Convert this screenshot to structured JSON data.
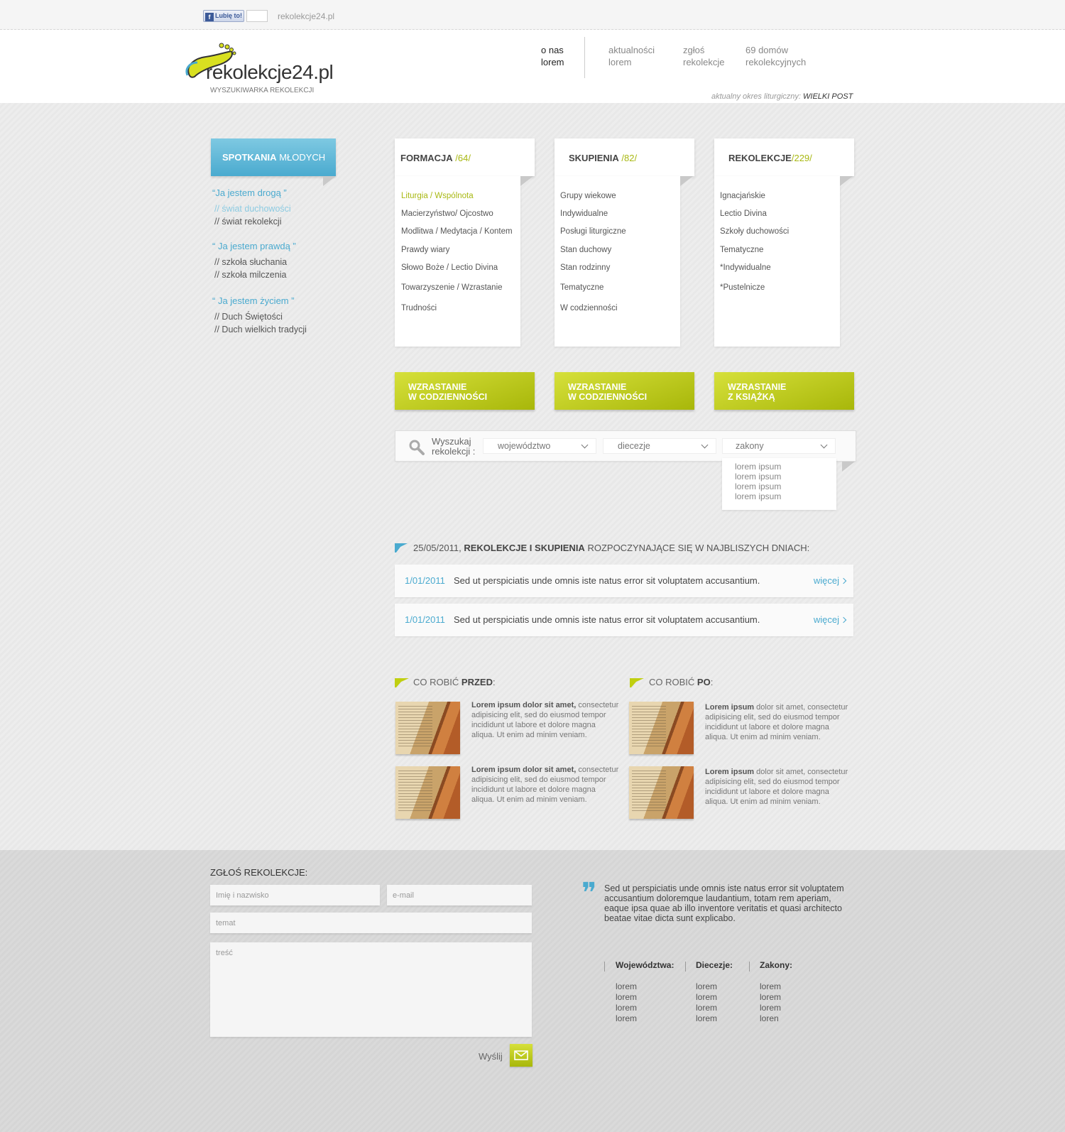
{
  "top": {
    "like_label": "Lubię to!",
    "site_url": "rekolekcje24.pl"
  },
  "logo": {
    "name": "rekolekcje24.pl",
    "tagline": "WYSZUKIWARKA REKOLEKCJI"
  },
  "nav": [
    {
      "line1": "o nas",
      "line2": "lorem"
    },
    {
      "line1": "aktualności",
      "line2": "lorem"
    },
    {
      "line1": "zgłoś",
      "line2": "rekolekcje"
    },
    {
      "line1": "69 domów",
      "line2": "rekolekcyjnych"
    }
  ],
  "liturgy": {
    "label": "aktualny okres liturgiczny:",
    "value": "WIELKI POST"
  },
  "youth_tab": {
    "bold": "SPOTKANIA",
    "light": "MŁODYCH"
  },
  "sidebar": [
    {
      "heading": "“Ja jestem drogą ”",
      "links": [
        "// świat duchowości",
        "// świat rekolekcji"
      ]
    },
    {
      "heading": "“ Ja jestem prawdą ”",
      "links": [
        "// szkoła słuchania",
        "// szkoła milczenia"
      ]
    },
    {
      "heading": "“ Ja jestem życiem ”",
      "links": [
        "// Duch Świętości",
        "// Duch wielkich tradycji"
      ]
    }
  ],
  "categories": [
    {
      "title": "FORMACJA",
      "count": " /64/",
      "items": [
        "Liturgia / Wspólnota",
        "Macierzyństwo/ Ojcostwo",
        "Modlitwa / Medytacja / Kontem",
        "Prawdy wiary",
        "Słowo Boże / Lectio Divina",
        "Towarzyszenie / Wzrastanie",
        "Trudności"
      ]
    },
    {
      "title": "SKUPIENIA",
      "count": " /82/",
      "items": [
        "Grupy wiekowe",
        "Indywidualne",
        "Posługi liturgiczne",
        "Stan duchowy",
        "Stan rodzinny",
        "Tematyczne",
        "W codzienności"
      ]
    },
    {
      "title": "REKOLEKCJE",
      "count": "/229/",
      "items": [
        "Ignacjańskie",
        "Lectio Divina",
        "Szkoły duchowości",
        "Tematyczne",
        "*Indywidualne",
        "*Pustelnicze"
      ]
    }
  ],
  "green_buttons": [
    {
      "line1": "WZRASTANIE",
      "line2": "W CODZIENNOŚCI"
    },
    {
      "line1": "WZRASTANIE",
      "line2": "W CODZIENNOŚCI"
    },
    {
      "line1": "WZRASTANIE",
      "line2": "Z KSIĄŻKĄ"
    }
  ],
  "search": {
    "label_line1": "Wyszukaj",
    "label_line2": "rekolekcji :",
    "selects": [
      "województwo",
      "diecezje",
      "zakony"
    ],
    "dropdown_options": [
      "lorem ipsum",
      "lorem ipsum",
      "lorem ipsum",
      "lorem ipsum"
    ]
  },
  "news": {
    "date": "25/05/2011,",
    "bold": "REKOLEKCJE I SKUPIENIA",
    "rest": "ROZPOCZYNAJĄCE SIĘ W NAJBLISZYCH DNIACH:",
    "rows": [
      {
        "date": "1/01/2011",
        "text": "Sed ut perspiciatis unde omnis iste natus error sit voluptatem accusantium.",
        "more": "więcej"
      },
      {
        "date": "1/01/2011",
        "text": "Sed ut perspiciatis unde omnis iste natus error sit voluptatem accusantium.",
        "more": "więcej"
      }
    ]
  },
  "before": {
    "title": "CO ROBIĆ",
    "bold": "PRZED",
    "colon": ":",
    "articles": [
      {
        "bold": "Lorem ipsum dolor sit amet,",
        "text": " consectetur adipisicing elit, sed do eiusmod tempor incididunt ut labore et dolore magna aliqua. Ut enim ad minim veniam."
      },
      {
        "bold": "Lorem ipsum dolor sit amet,",
        "text": " consectetur adipisicing elit, sed do eiusmod tempor incididunt ut labore et dolore magna aliqua. Ut enim ad minim veniam."
      }
    ]
  },
  "after": {
    "title": "CO ROBIĆ",
    "bold": "PO",
    "colon": ":",
    "articles": [
      {
        "bold": "Lorem ipsum",
        "text": " dolor sit amet, consectetur adipisicing elit, sed do eiusmod tempor incididunt ut labore et dolore magna aliqua. Ut enim ad minim veniam."
      },
      {
        "bold": "Lorem ipsum",
        "text": " dolor sit amet, consectetur adipisicing elit, sed do eiusmod tempor incididunt ut labore et dolore magna aliqua. Ut enim ad minim veniam."
      }
    ]
  },
  "form": {
    "title": "ZGŁOŚ REKOLEKCJE:",
    "name_placeholder": "Imię i nazwisko",
    "email_placeholder": "e-mail",
    "subject_placeholder": "temat",
    "body_placeholder": "treść",
    "send_label": "Wyślij"
  },
  "quote": "Sed ut perspiciatis unde omnis iste natus error sit voluptatem accusantium doloremque laudantium, totam rem aperiam, eaque ipsa quae ab illo inventore veritatis et quasi architecto beatae vitae dicta sunt explicabo.",
  "footer_columns": [
    {
      "heading": "Województwa:",
      "items": [
        "lorem",
        "lorem",
        "lorem",
        "lorem"
      ]
    },
    {
      "heading": "Diecezje:",
      "items": [
        "lorem",
        "lorem",
        "lorem",
        "lorem"
      ]
    },
    {
      "heading": "Zakony:",
      "items": [
        "lorem",
        "lorem",
        "lorem",
        "loren"
      ]
    }
  ],
  "colors": {
    "accent_blue": "#4aaacf",
    "accent_green": "#a8b812"
  }
}
